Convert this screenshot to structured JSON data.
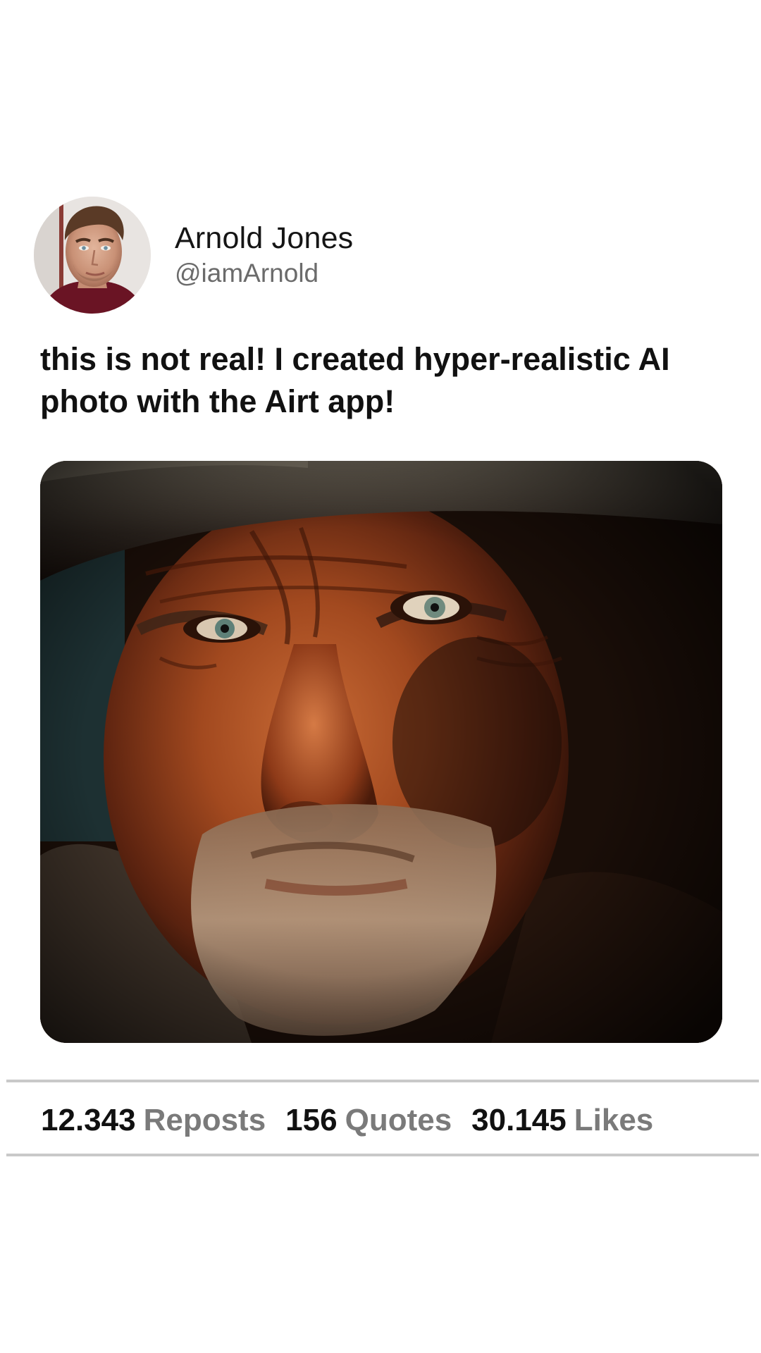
{
  "author": {
    "display_name": "Arnold Jones",
    "handle": "@iamArnold"
  },
  "post": {
    "text": "this is not real! I created hyper-realistic AI photo with the Airt app!"
  },
  "stats": [
    {
      "value": "12.343",
      "label": "Reposts"
    },
    {
      "value": "156",
      "label": "Quotes"
    },
    {
      "value": "30.145",
      "label": "Likes"
    }
  ]
}
